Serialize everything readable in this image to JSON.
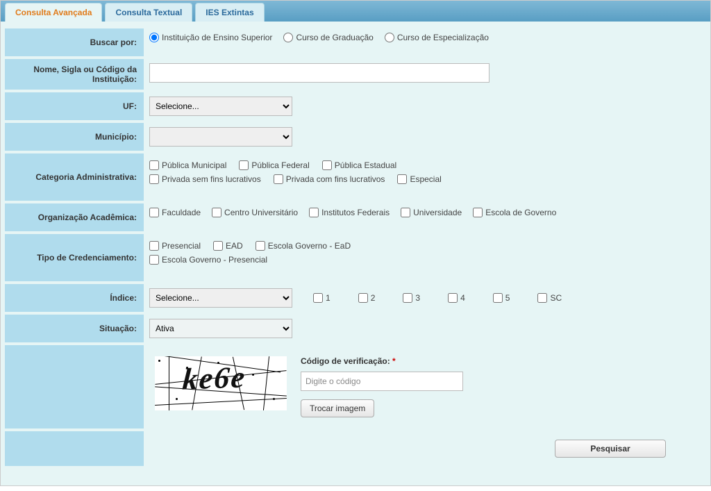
{
  "tabs": {
    "advanced": "Consulta Avançada",
    "textual": "Consulta Textual",
    "extintas": "IES Extintas"
  },
  "labels": {
    "buscar_por": "Buscar por:",
    "nome": "Nome, Sigla ou Código da Instituição:",
    "uf": "UF:",
    "municipio": "Município:",
    "categoria": "Categoria Administrativa:",
    "organizacao": "Organização Acadêmica:",
    "tipo_credenciamento": "Tipo de Credenciamento:",
    "indice": "Índice:",
    "situacao": "Situação:"
  },
  "buscar_por_options": {
    "ies": "Instituição de Ensino Superior",
    "graduacao": "Curso de Graduação",
    "especializacao": "Curso de Especialização"
  },
  "uf_placeholder": "Selecione...",
  "municipio_placeholder": "",
  "categoria_options": {
    "publica_municipal": "Pública Municipal",
    "publica_federal": "Pública Federal",
    "publica_estadual": "Pública Estadual",
    "privada_sem_fins": "Privada sem fins lucrativos",
    "privada_com_fins": "Privada com fins lucrativos",
    "especial": "Especial"
  },
  "organizacao_options": {
    "faculdade": "Faculdade",
    "centro": "Centro Universitário",
    "institutos": "Institutos Federais",
    "universidade": "Universidade",
    "escola_governo": "Escola de Governo"
  },
  "credenciamento_options": {
    "presencial": "Presencial",
    "ead": "EAD",
    "escola_gov_ead": "Escola Governo - EaD",
    "escola_gov_pres": "Escola Governo - Presencial"
  },
  "indice_placeholder": "Selecione...",
  "indice_values": {
    "v1": "1",
    "v2": "2",
    "v3": "3",
    "v4": "4",
    "v5": "5",
    "sc": "SC"
  },
  "situacao_value": "Ativa",
  "captcha": {
    "text": "ke6e",
    "label": "Código de verificação:",
    "required_mark": "*",
    "placeholder": "Digite o código",
    "trocar": "Trocar imagem"
  },
  "search_button": "Pesquisar"
}
